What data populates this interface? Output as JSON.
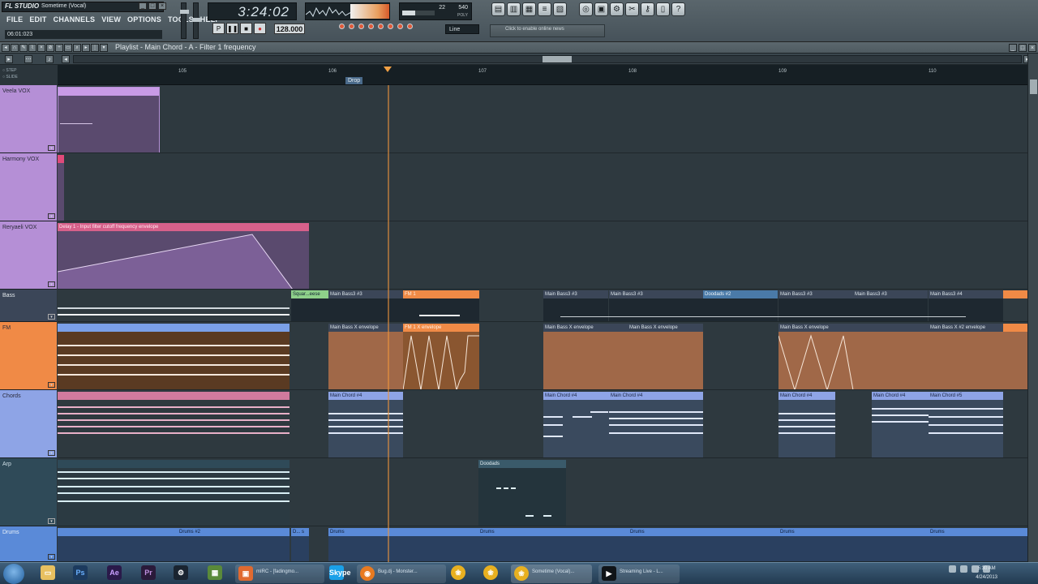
{
  "app": {
    "logo": "FL STUDIO",
    "song_title": "Sometime (Vocal)",
    "menu": [
      "FILE",
      "EDIT",
      "CHANNELS",
      "VIEW",
      "OPTIONS",
      "TOOLS",
      "HELP"
    ],
    "song_position": "06:01:023",
    "clock": "3:24:02",
    "tempo": "128.000",
    "cpu_value": "22",
    "memory_value": "540",
    "poly_label": "POLY",
    "snap_mode": "Line",
    "news_text": "Click to enable online news"
  },
  "playlist": {
    "title": "Playlist - Main Chord - A - Filter 1 frequency",
    "bars": [
      "105",
      "106",
      "107",
      "108",
      "109",
      "110"
    ],
    "markers": [
      "Drop"
    ],
    "tracks": [
      {
        "name": "Veela VOX",
        "color": "#b58fd6"
      },
      {
        "name": "Harmony VOX",
        "color": "#b58fd6"
      },
      {
        "name": "Reryaeli VOX",
        "color": "#b58fd6"
      },
      {
        "name": "Bass",
        "color": "#3b4658"
      },
      {
        "name": "FM",
        "color": "#f08a46"
      },
      {
        "name": "Chords",
        "color": "#8ea4e6"
      },
      {
        "name": "Arp",
        "color": "#2f4a58"
      },
      {
        "name": "Drums",
        "color": "#5a8ad8"
      }
    ],
    "clips": {
      "reryaeli": "Delay 1 - Input filter cutoff frequency envelope",
      "bass": [
        "Squar...eese",
        "Main Bass3 #3",
        "FM 1",
        "Main Bass3 #3",
        "Main Bass3 #3",
        "Doodads #2",
        "Main Bass3 #3",
        "Main Bass3 #3",
        "Main Bass3 #4"
      ],
      "fm": [
        "Main Bass X envelope",
        "FM 1 X envelope",
        "Main Bass X envelope",
        "Main Bass X envelope",
        "Main Bass X envelope",
        "Main Bass X #2 envelope"
      ],
      "chords": [
        "Main Chord #4",
        "Main Chord #4",
        "Main Chord #4",
        "Main Chord #4",
        "Main Chord #4",
        "Main Chord #5"
      ],
      "arp": [
        "Doodads"
      ],
      "drums": [
        "Drums #2",
        "D... s",
        "Drums",
        "Drums",
        "Drums",
        "Drums",
        "Drums"
      ]
    }
  },
  "taskbar": {
    "items": [
      "Ps",
      "Ae",
      "Pr",
      "mIRC - [fadingmo...",
      "Skype",
      "Bug.dj - Monster...",
      "Sometime (Vocal)...",
      "Streaming Live - L..."
    ],
    "time": "5:30 AM",
    "date": "4/24/2013"
  }
}
